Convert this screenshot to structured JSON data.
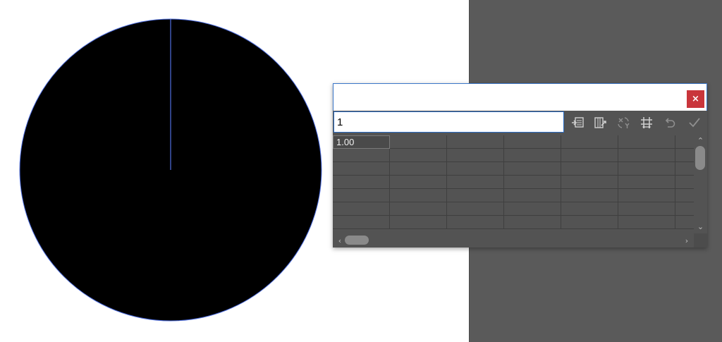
{
  "canvas": {
    "artboard_color": "#ffffff",
    "pasteboard_color": "#5a5a5a"
  },
  "chart_data": {
    "type": "pie",
    "values": [
      1.0
    ],
    "slice_colors": [
      "#000000"
    ],
    "separator_color": "#4f6fe0",
    "title": ""
  },
  "data_dialog": {
    "close_label": "×",
    "input_value": "1",
    "toolbar": {
      "icons": [
        "import-data-icon",
        "transpose-icon",
        "swap-xy-icon",
        "cell-style-icon",
        "revert-icon",
        "apply-icon"
      ]
    },
    "grid": {
      "columns": 7,
      "visible_rows": 7,
      "cells": [
        [
          "1.00",
          "",
          "",
          "",
          "",
          "",
          ""
        ]
      ]
    },
    "scrollbars": {
      "up": "⌃",
      "down": "⌄",
      "left": "‹",
      "right": "›"
    }
  }
}
